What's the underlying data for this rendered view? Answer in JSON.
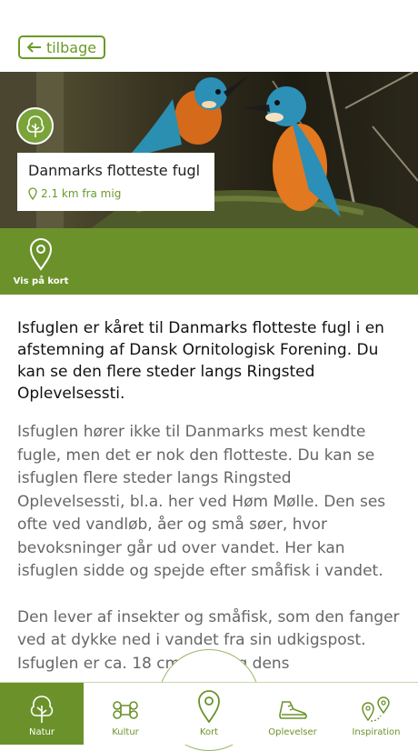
{
  "header": {
    "back_label": "tilbage"
  },
  "hero": {
    "category_icon": "tree-icon",
    "title": "Danmarks flotteste fugl",
    "distance": "2.1 km fra mig"
  },
  "map_action": {
    "label": "Vis på kort",
    "icon": "map-pin-icon"
  },
  "article": {
    "lead": "Isfuglen er kåret til Danmarks flotteste fugl i en afstemning af Dansk Ornitologisk Forening. Du kan se den flere steder langs Ringsted Oplevelsessti.",
    "paragraphs": [
      "Isfuglen hører ikke til Danmarks mest kendte fugle, men det er nok den flotteste. Du kan se isfuglen flere steder langs Ringsted Oplevelsessti, bl.a. her ved Høm Mølle. Den ses ofte ved vandløb, åer og små søer, hvor bevoksninger går ud over vandet. Her kan isfuglen sidde og spejde efter småfisk i vandet.",
      "Den lever af insekter og småfisk, som den fanger ved at dykke ned i vandet fra sin udkigspost. Isfuglen er ca. 18 cm lang, og dens"
    ]
  },
  "tabbar": {
    "tabs": [
      {
        "label": "Natur",
        "icon": "tree-icon",
        "active": true
      },
      {
        "label": "Kultur",
        "icon": "command-icon",
        "active": false
      },
      {
        "label": "Kort",
        "icon": "map-pin-icon",
        "active": false
      },
      {
        "label": "Oplevelser",
        "icon": "shoe-icon",
        "active": false
      },
      {
        "label": "Inspiration",
        "icon": "route-pins-icon",
        "active": false
      }
    ]
  },
  "colors": {
    "accent": "#6b922a",
    "accent_light": "#7aa33a",
    "text": "#222222",
    "muted_text": "#666666"
  }
}
